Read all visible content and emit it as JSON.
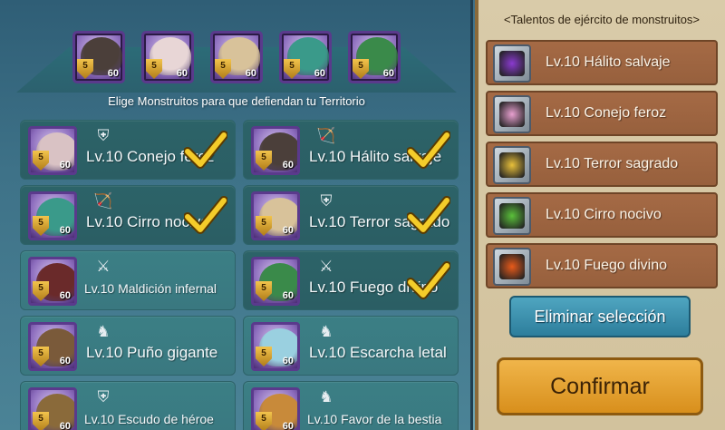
{
  "defenders": [
    {
      "name": "defender-halito",
      "level": "5",
      "power": "60",
      "color": "#4b3f3a"
    },
    {
      "name": "defender-conejo",
      "level": "5",
      "power": "60",
      "color": "#e8d6d6"
    },
    {
      "name": "defender-terror",
      "level": "5",
      "power": "60",
      "color": "#d8c29a"
    },
    {
      "name": "defender-cirro",
      "level": "5",
      "power": "60",
      "color": "#3a9a8a"
    },
    {
      "name": "defender-fuego",
      "level": "5",
      "power": "60",
      "color": "#3a8a4a"
    }
  ],
  "choose_text": "Elige Monstruitos para que defiendan tu Territorio",
  "monsters": [
    {
      "label": "Lv.10 Conejo feroz",
      "level": "5",
      "power": "60",
      "icon": "shield-icon",
      "selected": true,
      "color": "#d9c2c4"
    },
    {
      "label": "Lv.10 Hálito salvaje",
      "level": "5",
      "power": "60",
      "icon": "bow-icon",
      "selected": true,
      "color": "#4b3f3a"
    },
    {
      "label": "Lv.10 Cirro nocivo",
      "level": "5",
      "power": "60",
      "icon": "bow-icon",
      "selected": true,
      "color": "#3a9a8a"
    },
    {
      "label": "Lv.10 Terror sagrado",
      "level": "5",
      "power": "60",
      "icon": "shield-icon",
      "selected": true,
      "color": "#d8c29a"
    },
    {
      "label": "Lv.10 Maldición infernal",
      "level": "5",
      "power": "60",
      "icon": "bow-shield-icon",
      "selected": false,
      "color": "#6a2a2a"
    },
    {
      "label": "Lv.10 Fuego divino",
      "level": "5",
      "power": "60",
      "icon": "bow-shield-icon",
      "selected": true,
      "color": "#3a8a4a"
    },
    {
      "label": "Lv.10 Puño gigante",
      "level": "5",
      "power": "60",
      "icon": "knight-icon",
      "selected": false,
      "color": "#7a5a3a"
    },
    {
      "label": "Lv.10 Escarcha letal",
      "level": "5",
      "power": "60",
      "icon": "knight-icon",
      "selected": false,
      "color": "#9ad0e0"
    },
    {
      "label": "Lv.10 Escudo de héroe",
      "level": "5",
      "power": "60",
      "icon": "shield-icon",
      "selected": false,
      "color": "#8a6a3a"
    },
    {
      "label": "Lv.10 Favor de la bestia",
      "level": "5",
      "power": "60",
      "icon": "knight-icon",
      "selected": false,
      "color": "#c88a3a"
    }
  ],
  "right": {
    "title": "<Talentos de ejército de monstruitos>",
    "talents": [
      {
        "label": "Lv.10 Hálito salvaje",
        "color": "#8a3ad0"
      },
      {
        "label": "Lv.10 Conejo feroz",
        "color": "#e8a0d0"
      },
      {
        "label": "Lv.10 Terror sagrado",
        "color": "#e8c03a"
      },
      {
        "label": "Lv.10 Cirro nocivo",
        "color": "#5ac03a"
      },
      {
        "label": "Lv.10 Fuego divino",
        "color": "#e85a1a"
      }
    ],
    "clear_label": "Eliminar selección",
    "confirm_label": "Confirmar"
  }
}
